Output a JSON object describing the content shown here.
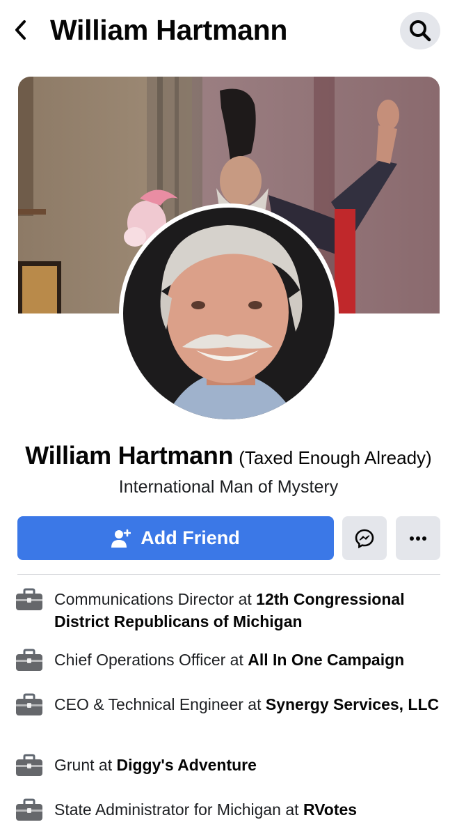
{
  "header": {
    "title": "William Hartmann",
    "back_icon": "chevron-left-icon",
    "search_icon": "search-icon"
  },
  "profile": {
    "name": "William Hartmann",
    "alternate_name": "(Taxed Enough Already)",
    "tagline": "International Man of Mystery"
  },
  "actions": {
    "add_friend_label": "Add Friend",
    "add_friend_icon": "add-person-icon",
    "messenger_icon": "messenger-icon",
    "more_icon": "more-dots-icon",
    "primary_color": "#3b78e7"
  },
  "work": [
    {
      "role": "Communications Director at ",
      "org": "12th Congressional District Republicans of Michigan"
    },
    {
      "role": "Chief Operations Officer at ",
      "org": "All In One Campaign"
    },
    {
      "role": "CEO & Technical Engineer at ",
      "org": "Synergy Services, LLC"
    },
    {
      "role": "Grunt at ",
      "org": "Diggy's Adventure"
    },
    {
      "role": "State Administrator for Michigan at ",
      "org": "RVotes"
    }
  ]
}
